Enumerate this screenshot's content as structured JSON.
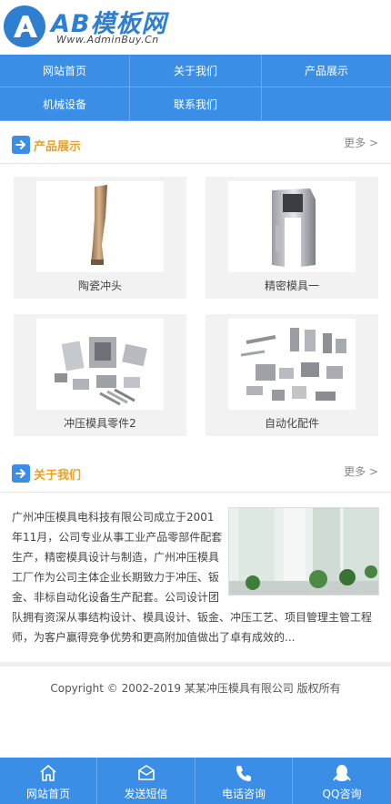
{
  "header": {
    "logo_text": "AB模板网",
    "logo_sub": "Www.AdminBuy.Cn"
  },
  "nav": {
    "items": [
      {
        "label": "网站首页"
      },
      {
        "label": "关于我们"
      },
      {
        "label": "产品展示"
      },
      {
        "label": "机械设备"
      },
      {
        "label": "联系我们"
      }
    ]
  },
  "products_section": {
    "title": "产品展示",
    "more": "更多 >",
    "items": [
      {
        "name": "陶瓷冲头"
      },
      {
        "name": "精密模具一"
      },
      {
        "name": "冲压模具零件2"
      },
      {
        "name": "自动化配件"
      }
    ]
  },
  "about_section": {
    "title": "关于我们",
    "more": "更多 >",
    "text": "广州冲压模具电科技有限公司成立于2001年11月，公司专业从事工业产品零部件配套生产，精密模具设计与制造，广州冲压模具工厂作为公司主体企业长期致力于冲压、钣金、非标自动化设备生产配套。公司设计团队拥有资深从事结构设计、模具设计、钣金、冲压工艺、项目管理主管工程师，为客户赢得竞争优势和更高附加值做出了卓有成效的..."
  },
  "footer": {
    "copyright": "Copyright © 2002-2019 某某冲压模具有限公司 版权所有"
  },
  "bottom_bar": {
    "items": [
      {
        "label": "网站首页",
        "icon": "home-icon"
      },
      {
        "label": "发送短信",
        "icon": "envelope-icon"
      },
      {
        "label": "电话咨询",
        "icon": "phone-icon"
      },
      {
        "label": "QQ咨询",
        "icon": "qq-icon"
      }
    ]
  },
  "colors": {
    "primary": "#3a8ee6",
    "accent": "#f0a020"
  }
}
